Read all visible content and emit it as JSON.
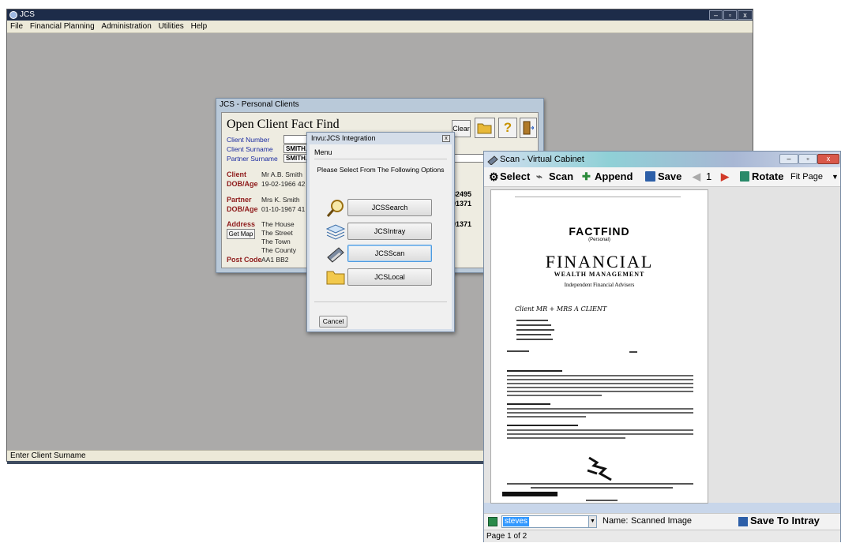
{
  "app": {
    "title": "JCS",
    "menu": [
      "File",
      "Financial Planning",
      "Administration",
      "Utilities",
      "Help"
    ],
    "status": "Enter Client Surname",
    "window_buttons": [
      "–",
      "▫",
      "x"
    ]
  },
  "personal_clients": {
    "title": "JCS - Personal Clients",
    "heading": "Open Client Fact Find",
    "clear_label": "Clear",
    "fields": {
      "client_number_label": "Client Number",
      "client_number_value": "",
      "client_surname_label": "Client Surname",
      "client_surname_value": "SMITH,",
      "partner_surname_label": "Partner Surname",
      "partner_surname_value": "SMITH,"
    },
    "client_label": "Client",
    "client_value": "Mr A.B. Smith",
    "dob_label": "DOB/Age",
    "client_dob": "19-02-1966  42",
    "partner_label": "Partner",
    "partner_value": "Mrs K. Smith",
    "partner_dob": "01-10-1967  41",
    "address_label": "Address",
    "get_map_label": "Get Map",
    "address_lines": [
      "The House",
      "The Street",
      "The Town",
      "The County"
    ],
    "postcode_label": "Post Code",
    "postcode_value": "AA1 BB2",
    "right_numbers": [
      "532495",
      "891371",
      "891371"
    ]
  },
  "integration": {
    "title": "Invu:JCS Integration",
    "menu_label": "Menu",
    "prompt": "Please Select From The Following Options",
    "options": [
      "JCSSearch",
      "JCSIntray",
      "JCSScan",
      "JCSLocal"
    ],
    "cancel_label": "Cancel",
    "close_label": "x"
  },
  "scan": {
    "title": "Scan - Virtual Cabinet",
    "toolbar": {
      "select": "Select",
      "scan": "Scan",
      "append": "Append",
      "save": "Save",
      "page": "1",
      "rotate": "Rotate",
      "fit": "Fit Page"
    },
    "document": {
      "title": "FACTFIND",
      "subtitle": "(Personal)",
      "brand": "FINANCIAL",
      "brand2": "WEALTH MANAGEMENT",
      "tagline": "Independent Financial Advisers",
      "handwritten": "Client   MR + MRS  A  CLIENT"
    },
    "bottom": {
      "user": "steves",
      "name_label": "Name:",
      "name_value": "Scanned Image",
      "save_intray": "Save To Intray"
    },
    "status": "Page 1 of 2"
  },
  "colors": {
    "titlebar": "#1d2c49",
    "desktop": "#abaaa9",
    "label_blue": "#1b2ba1",
    "label_red": "#8e1a1a"
  }
}
